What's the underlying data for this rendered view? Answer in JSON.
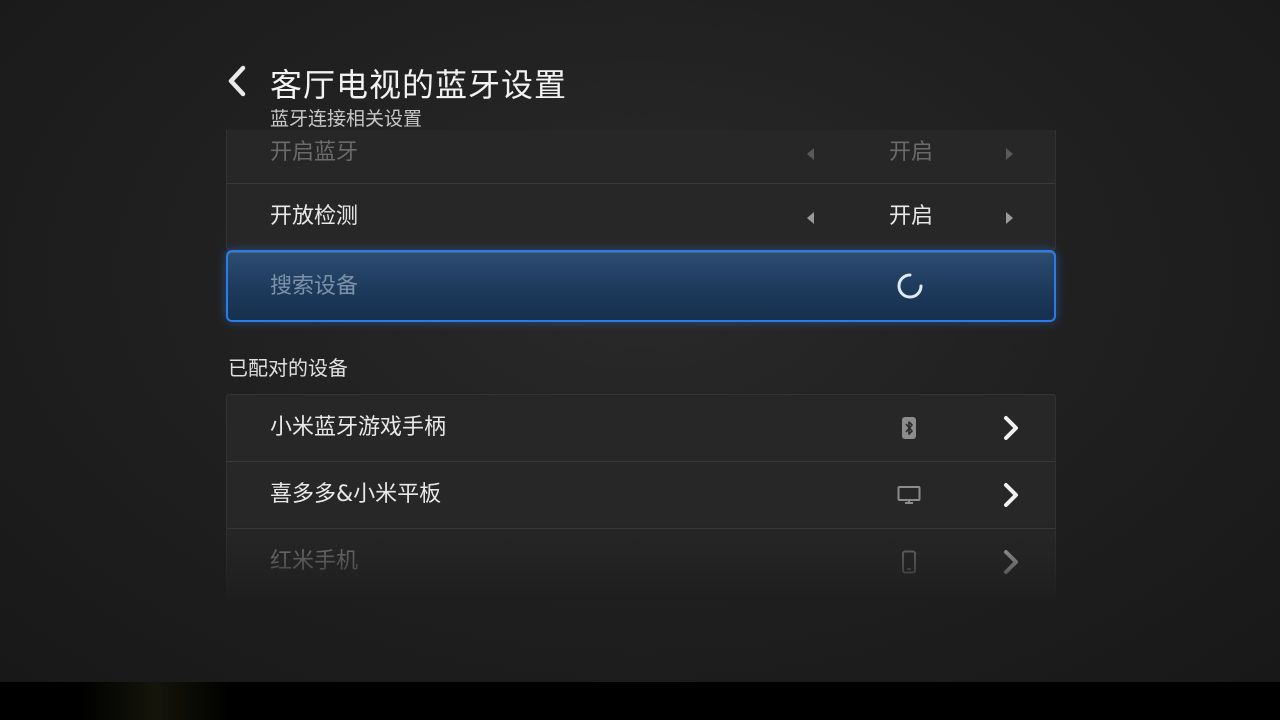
{
  "header": {
    "title": "客厅电视的蓝牙设置",
    "subtitle": "蓝牙连接相关设置"
  },
  "settings": [
    {
      "label": "开启蓝牙",
      "value": "开启"
    },
    {
      "label": "开放检测",
      "value": "开启"
    }
  ],
  "search": {
    "label": "搜索设备"
  },
  "paired": {
    "title": "已配对的设备",
    "devices": [
      {
        "name": "小米蓝牙游戏手柄",
        "icon": "bluetooth-icon"
      },
      {
        "name": "喜多多&小米平板",
        "icon": "monitor-icon"
      },
      {
        "name": "红米手机",
        "icon": "phone-icon"
      }
    ]
  },
  "colors": {
    "focus_border": "#2d7be6",
    "focus_fill": "#1d3a5c",
    "panel": "#272727",
    "background": "#1f1f1f"
  }
}
